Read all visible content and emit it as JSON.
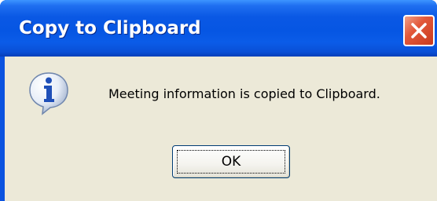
{
  "dialog": {
    "title": "Copy to Clipboard",
    "message": "Meeting information is copied to Clipboard.",
    "ok_label": "OK",
    "icon": "info-icon",
    "close_icon": "close-icon"
  },
  "colors": {
    "titlebar": "#0656e3",
    "client_background": "#ece9d8",
    "close_button": "#e2583a",
    "title_text": "#ffffff"
  }
}
